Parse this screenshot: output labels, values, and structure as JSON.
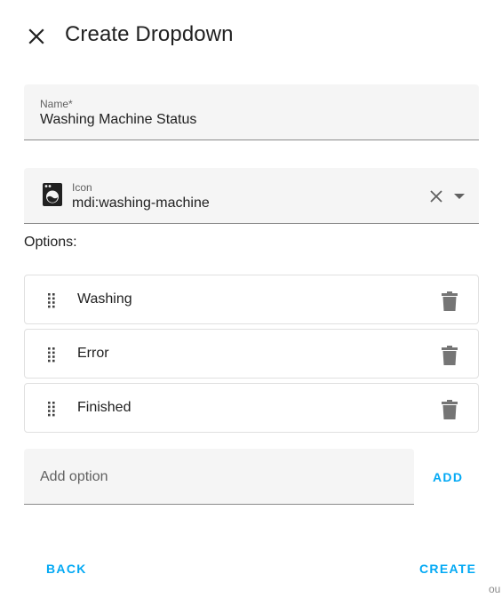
{
  "dialog": {
    "title": "Create Dropdown",
    "close_icon": "close-icon"
  },
  "name_field": {
    "label": "Name*",
    "value": "Washing Machine Status"
  },
  "icon_field": {
    "label": "Icon",
    "value": "mdi:washing-machine",
    "prefix_icon": "washing-machine-icon",
    "clear_icon": "close-icon",
    "dropdown_icon": "caret-down-icon"
  },
  "options": {
    "label": "Options:",
    "items": [
      {
        "label": "Washing"
      },
      {
        "label": "Error"
      },
      {
        "label": "Finished"
      }
    ],
    "drag_icon": "drag-handle-icon",
    "delete_icon": "trash-icon"
  },
  "add_option": {
    "placeholder": "Add option",
    "value": "",
    "button_label": "ADD"
  },
  "footer": {
    "back_label": "BACK",
    "create_label": "CREATE"
  },
  "background_fragment": "ou",
  "colors": {
    "accent": "#03a9f4",
    "field_background": "#f5f5f5",
    "text_primary": "#212121",
    "text_secondary": "#616161",
    "icon": "#616161"
  }
}
